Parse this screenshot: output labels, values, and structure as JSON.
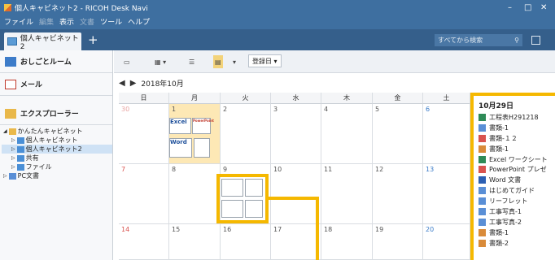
{
  "window": {
    "title": "個人キャビネット2 - RICOH Desk Navi"
  },
  "menu": [
    "ファイル",
    "編集",
    "表示",
    "文書",
    "ツール",
    "ヘルプ"
  ],
  "menu_disabled": [
    false,
    true,
    false,
    true,
    false,
    false
  ],
  "tab": {
    "label": "個人キャビネット2",
    "add": "+"
  },
  "search": {
    "placeholder": "すべてから検索",
    "icon": "search-icon"
  },
  "sidebar": {
    "sections": [
      {
        "label": "おしごとルーム",
        "icon": "office-room-icon"
      },
      {
        "label": "メール",
        "icon": "mail-icon"
      },
      {
        "label": "エクスプローラー",
        "icon": "folder-icon"
      }
    ],
    "tree": [
      {
        "label": "かんたんキャビネット",
        "depth": 0,
        "toggle": "◢"
      },
      {
        "label": "個人キャビネット",
        "depth": 1,
        "toggle": "▷"
      },
      {
        "label": "個人キャビネット2",
        "depth": 1,
        "toggle": "▷",
        "selected": true
      },
      {
        "label": "共有",
        "depth": 1,
        "toggle": "▷"
      },
      {
        "label": "ファイル",
        "depth": 1,
        "toggle": "▷"
      },
      {
        "label": "PC文書",
        "depth": 0,
        "toggle": "▷"
      }
    ]
  },
  "toolbar": {
    "sort_label": "登録日"
  },
  "calendar": {
    "month_label": "2018年10月",
    "weekdays": [
      "日",
      "月",
      "火",
      "水",
      "木",
      "金",
      "土"
    ],
    "weeks": [
      [
        "30",
        "1",
        "2",
        "3",
        "4",
        "5",
        "6"
      ],
      [
        "7",
        "8",
        "9",
        "10",
        "11",
        "12",
        "13"
      ],
      [
        "14",
        "15",
        "16",
        "17",
        "18",
        "19",
        "20"
      ]
    ],
    "doc_excel": "Excel",
    "doc_word": "Word",
    "doc_ppt": "PowerPoint"
  },
  "popup": {
    "date": "10月29日",
    "items": [
      {
        "label": "工程表H291218",
        "icon": "excel-icon",
        "color": "#2e8b57"
      },
      {
        "label": "書類-1",
        "icon": "doc-icon",
        "color": "#5a8fd6"
      },
      {
        "label": "書類-１２",
        "icon": "pdf-icon",
        "color": "#d9534f"
      },
      {
        "label": "書類-1",
        "icon": "image-icon",
        "color": "#d98b3a"
      },
      {
        "label": "Excel ワークシート",
        "icon": "excel-icon",
        "color": "#2e8b57"
      },
      {
        "label": "PowerPoint プレゼ",
        "icon": "ppt-icon",
        "color": "#d9534f"
      },
      {
        "label": "Word 文書",
        "icon": "word-icon",
        "color": "#2b5fb3"
      },
      {
        "label": "はじめてガイド",
        "icon": "doc-icon",
        "color": "#5a8fd6"
      },
      {
        "label": "リーフレット",
        "icon": "doc-icon",
        "color": "#5a8fd6"
      },
      {
        "label": "工事写真-1",
        "icon": "doc-icon",
        "color": "#5a8fd6"
      },
      {
        "label": "工事写真-2",
        "icon": "doc-icon",
        "color": "#5a8fd6"
      },
      {
        "label": "書類-1",
        "icon": "image-icon",
        "color": "#d98b3a"
      },
      {
        "label": "書類-2",
        "icon": "image-icon",
        "color": "#d98b3a"
      }
    ]
  },
  "colors": {
    "titlebar": "#3e6fa0",
    "highlight": "#f5b800",
    "selected_day": "#fde8b5"
  }
}
